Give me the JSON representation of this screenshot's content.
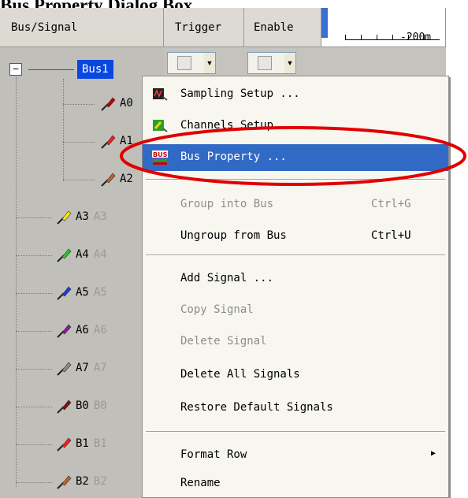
{
  "doc_title": "Bus Property Dialog Box",
  "header": {
    "col_bus_signal": "Bus/Signal",
    "col_trigger": "Trigger",
    "col_enable": "Enable",
    "timeline_label": "-200m"
  },
  "tree": {
    "expander": "−",
    "bus_label": "Bus1",
    "bus_children": [
      {
        "name": "A0",
        "color": "#c00000"
      },
      {
        "name": "A1",
        "color": "#ff1a1a"
      },
      {
        "name": "A2",
        "color": "#c0602a"
      }
    ],
    "signals": [
      {
        "name": "A3",
        "alias": "A3",
        "color": "#ffee00"
      },
      {
        "name": "A4",
        "alias": "A4",
        "color": "#22cc22"
      },
      {
        "name": "A5",
        "alias": "A5",
        "color": "#1a3ad6"
      },
      {
        "name": "A6",
        "alias": "A6",
        "color": "#8a1a9a"
      },
      {
        "name": "A7",
        "alias": "A7",
        "color": "#8a8a8a"
      },
      {
        "name": "B0",
        "alias": "B0",
        "color": "#7a1010"
      },
      {
        "name": "B1",
        "alias": "B1",
        "color": "#ff1a1a"
      },
      {
        "name": "B2",
        "alias": "B2",
        "color": "#c0602a"
      }
    ]
  },
  "context_menu": {
    "items": [
      {
        "label": "Sampling Setup ...",
        "shortcut": "",
        "state": "enabled",
        "icon": "sampling-icon"
      },
      {
        "label": "Channels Setup",
        "shortcut": "",
        "state": "enabled",
        "icon": "channels-icon"
      },
      {
        "label": "Bus Property ...",
        "shortcut": "",
        "state": "selected",
        "icon": "bus-icon"
      },
      {
        "label": "Group into Bus",
        "shortcut": "Ctrl+G",
        "state": "disabled"
      },
      {
        "label": "Ungroup from Bus",
        "shortcut": "Ctrl+U",
        "state": "enabled"
      },
      {
        "label": "Add Signal ...",
        "shortcut": "",
        "state": "enabled"
      },
      {
        "label": "Copy Signal",
        "shortcut": "",
        "state": "disabled"
      },
      {
        "label": "Delete Signal",
        "shortcut": "",
        "state": "disabled"
      },
      {
        "label": "Delete All Signals",
        "shortcut": "",
        "state": "enabled"
      },
      {
        "label": "Restore Default Signals",
        "shortcut": "",
        "state": "enabled"
      },
      {
        "label": "Format Row",
        "shortcut": "",
        "state": "enabled",
        "submenu": true
      },
      {
        "label": "Rename",
        "shortcut": "",
        "state": "enabled"
      }
    ],
    "bus_icon_text": "BUS",
    "submenu_arrow": "▶"
  },
  "colors": {
    "highlight": "#316ac5",
    "annotation_ring": "#e00000",
    "bus_label_bg": "#0a46e0"
  }
}
